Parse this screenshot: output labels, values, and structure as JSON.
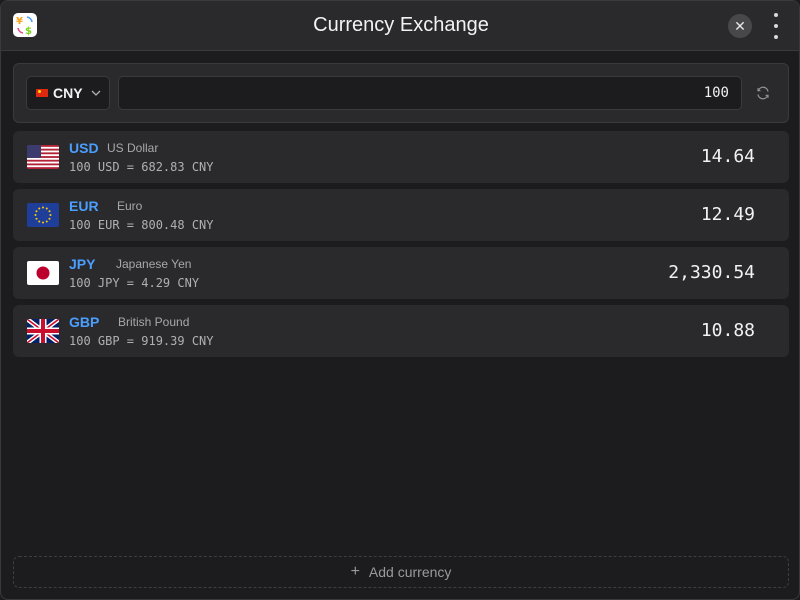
{
  "window": {
    "title": "Currency Exchange",
    "close_glyph": "✕",
    "icons": {
      "app": "currency-exchange-icon",
      "close": "close-icon",
      "more": "more-vertical-icon"
    }
  },
  "converter": {
    "base_currency": "CNY",
    "base_flag": "cn-flag-icon",
    "amount": "100",
    "refresh_icon": "refresh-icon",
    "dropdown_icon": "chevron-down-icon"
  },
  "rates": [
    {
      "code": "USD",
      "name": "US Dollar",
      "rate_text": "100 USD = 682.83 CNY",
      "converted": "14.64",
      "flag": "us-flag-icon"
    },
    {
      "code": "EUR",
      "name": "Euro",
      "rate_text": "100 EUR = 800.48 CNY",
      "converted": "12.49",
      "flag": "eu-flag-icon"
    },
    {
      "code": "JPY",
      "name": "Japanese Yen",
      "rate_text": "100 JPY = 4.29 CNY",
      "converted": "2,330.54",
      "flag": "jp-flag-icon"
    },
    {
      "code": "GBP",
      "name": "British Pound",
      "rate_text": "100 GBP = 919.39 CNY",
      "converted": "10.88",
      "flag": "gb-flag-icon"
    }
  ],
  "footer": {
    "add_label": "Add currency",
    "add_glyph": "+"
  },
  "colors": {
    "accent": "#4a9eff",
    "background": "#1c1c1e",
    "panel": "#2a2a2c"
  }
}
